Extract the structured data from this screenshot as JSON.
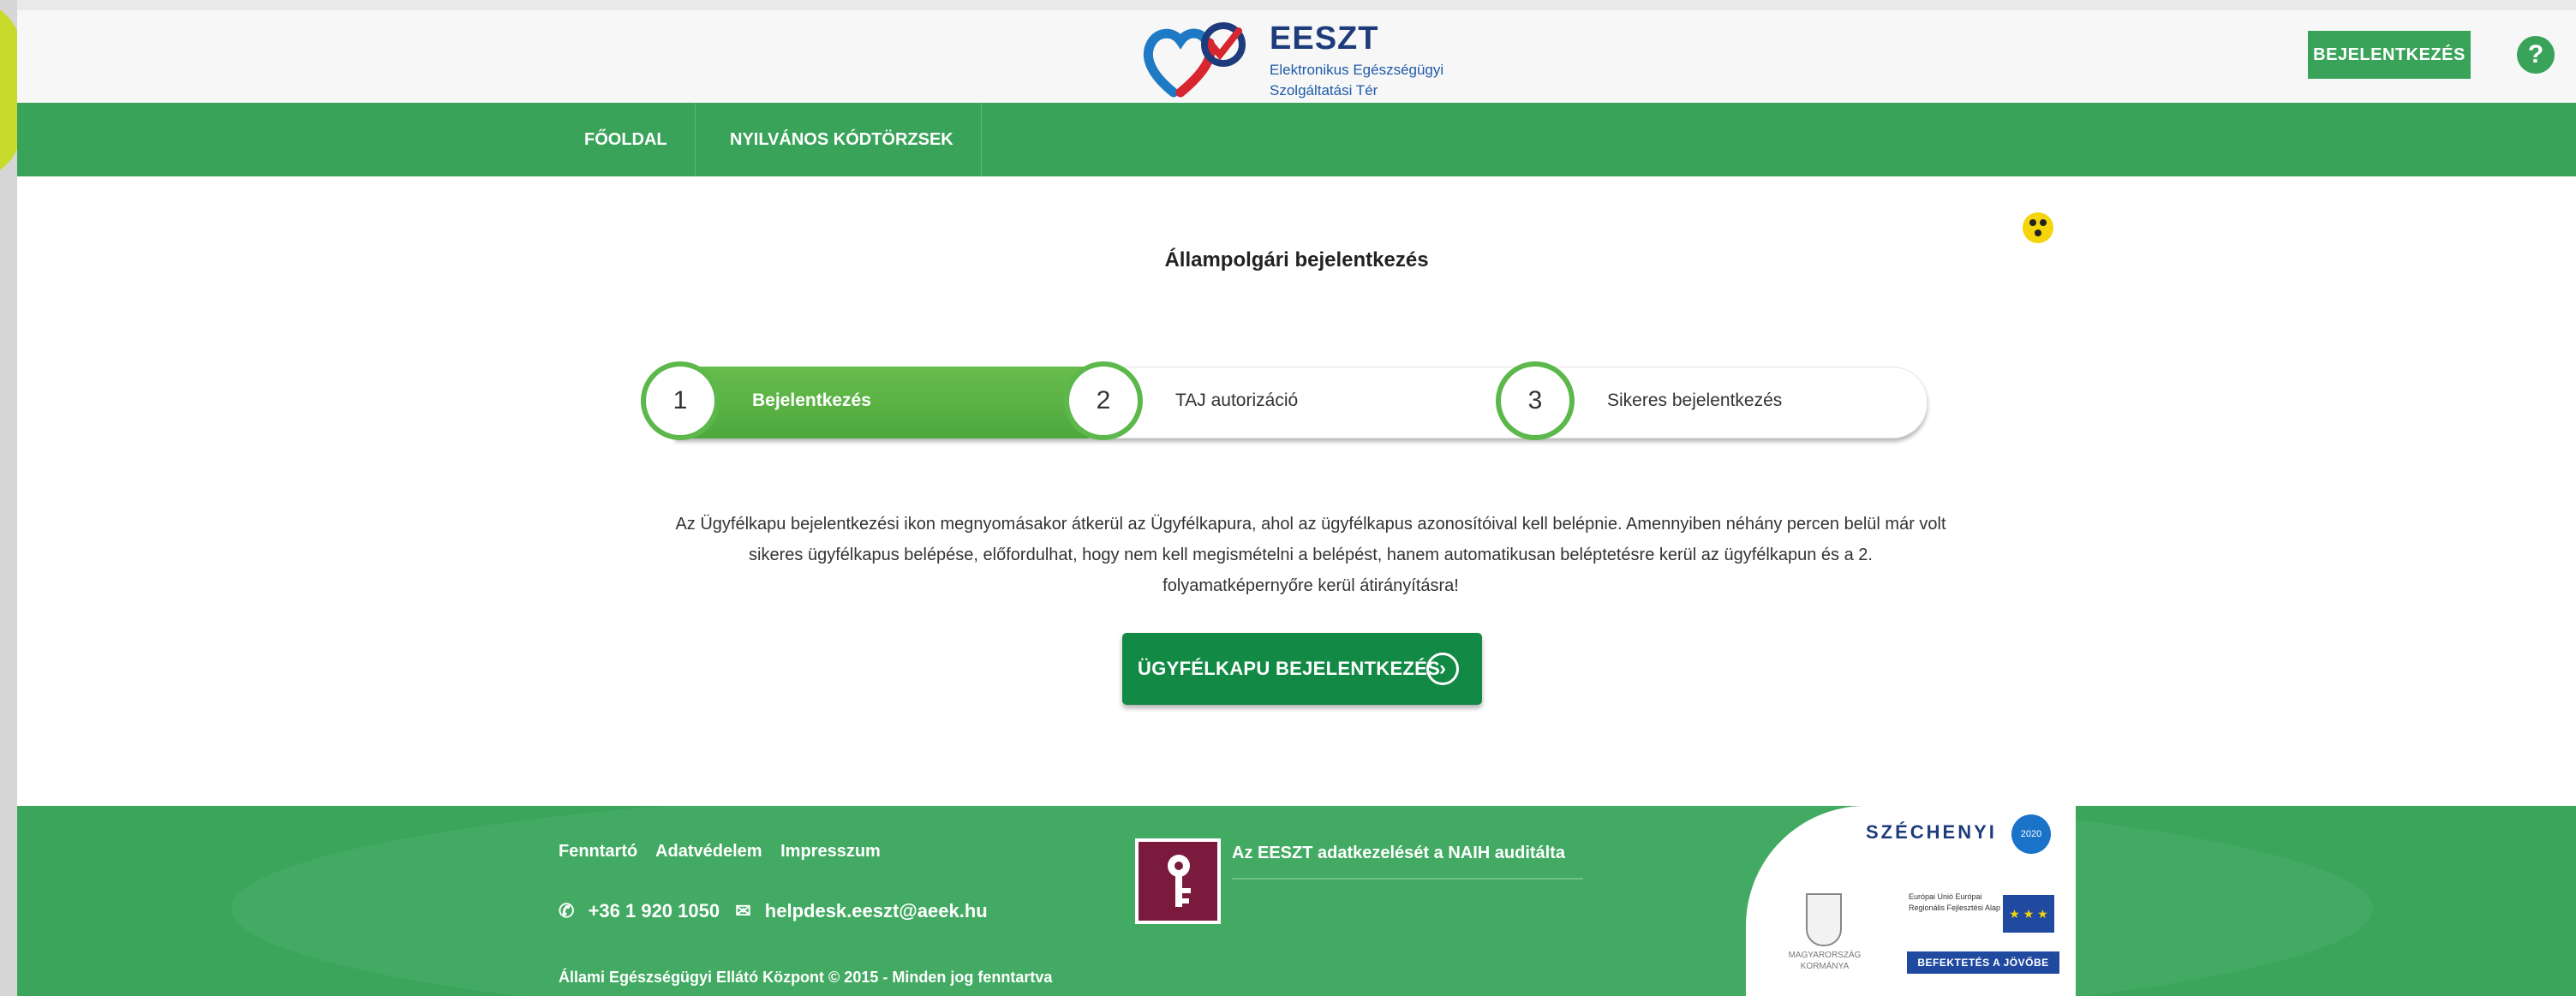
{
  "header": {
    "logo_title": "EESZT",
    "logo_subtitle_line1": "Elektronikus Egészségügyi",
    "logo_subtitle_line2": "Szolgáltatási Tér",
    "login_button": "BEJELENTKEZÉS",
    "help_icon": "?"
  },
  "nav": {
    "items": [
      {
        "label": "FŐOLDAL"
      },
      {
        "label": "NYILVÁNOS KÓDTÖRZSEK"
      }
    ],
    "accessibility_icon": "accessibility-icon"
  },
  "main": {
    "title": "Állampolgári bejelentkezés",
    "steps": [
      {
        "number": "1",
        "label": "Bejelentkezés",
        "active": true
      },
      {
        "number": "2",
        "label": "TAJ autorizáció",
        "active": false
      },
      {
        "number": "3",
        "label": "Sikeres bejelentkezés",
        "active": false
      }
    ],
    "description_line1": "Az Ügyfélkapu bejelentkezési ikon megnyomásakor átkerül az Ügyfélkapura, ahol az ügyfélkapus azonosítóival kell belépnie. Amennyiben néhány percen belül már volt",
    "description_line2": "sikeres ügyfélkapus belépése, előfordulhat, hogy nem kell megismételni a belépést, hanem automatikusan beléptetésre kerül az ügyfélkapun és a 2.",
    "description_line3": "folyamatképernyőre kerül átirányításra!",
    "cta_button": "ÜGYFÉLKAPU BEJELENTKEZÉS"
  },
  "footer": {
    "links": [
      "Fenntartó",
      "Adatvédelem",
      "Impresszum"
    ],
    "phone": "+36 1 920 1050",
    "email": "helpdesk.eeszt@aeek.hu",
    "copyright": "Állami Egészségügyi Ellátó Központ © 2015 - Minden jog fenntartva",
    "naih_text": "Az EESZT adatkezelését a NAIH auditálta",
    "szechenyi": "SZÉCHENYI",
    "szechenyi_year": "2020",
    "gov_name": "MAGYARORSZÁG KORMÁNYA",
    "eu_text": "Európai Unió Európai Regionális Fejlesztési Alap",
    "invest_label": "BEFEKTETÉS A JÖVŐBE"
  },
  "colors": {
    "brand_green": "#3aa35a",
    "cta_green": "#128a45",
    "step_green": "#5cb84a",
    "logo_blue": "#1e3b7b"
  }
}
